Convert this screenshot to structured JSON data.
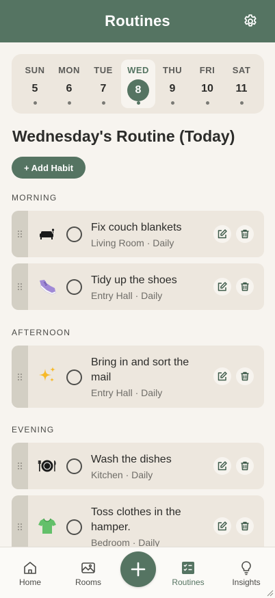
{
  "header": {
    "title": "Routines",
    "settings_icon": "gear-icon"
  },
  "week": [
    {
      "name": "SUN",
      "num": "5"
    },
    {
      "name": "MON",
      "num": "6"
    },
    {
      "name": "TUE",
      "num": "7"
    },
    {
      "name": "WED",
      "num": "8",
      "selected": true
    },
    {
      "name": "THU",
      "num": "9"
    },
    {
      "name": "FRI",
      "num": "10"
    },
    {
      "name": "SAT",
      "num": "11"
    }
  ],
  "routine": {
    "title": "Wednesday's Routine (Today)",
    "add_label": "+ Add Habit"
  },
  "sections": {
    "morning": "MORNING",
    "afternoon": "AFTERNOON",
    "evening": "EVENING"
  },
  "habits": [
    {
      "name": "Fix couch blankets",
      "meta": "Living Room · Daily",
      "icon": "couch-icon"
    },
    {
      "name": "Tidy up the shoes",
      "meta": "Entry Hall · Daily",
      "icon": "sneaker-icon"
    },
    {
      "name": "Bring in and sort the mail",
      "meta": "Entry Hall · Daily",
      "icon": "sparkles-icon"
    },
    {
      "name": "Wash the dishes",
      "meta": "Kitchen · Daily",
      "icon": "plate-cutlery-icon"
    },
    {
      "name": "Toss clothes in the hamper.",
      "meta": "Bedroom · Daily",
      "icon": "tshirt-icon"
    }
  ],
  "nav": {
    "home": "Home",
    "rooms": "Rooms",
    "routines": "Routines",
    "insights": "Insights",
    "active": "routines"
  },
  "colors": {
    "brand": "#557462",
    "background": "#f7f4ef",
    "card": "#ede7de",
    "handle": "#d3cfc4"
  }
}
